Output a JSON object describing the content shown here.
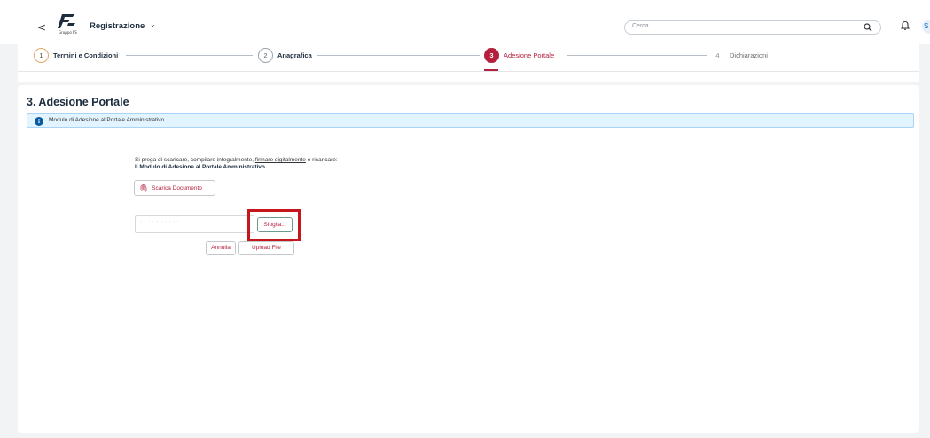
{
  "shell": {
    "back_glyph": "<",
    "logo_caption": "Gruppo FS",
    "app_title": "Registrazione",
    "app_menu_glyph": "⌄",
    "search_placeholder": "Cerca",
    "avatar_initial": "S"
  },
  "wizard": {
    "steps": [
      {
        "number": "1",
        "label": "Termini e Condizioni",
        "state": "done"
      },
      {
        "number": "2",
        "label": "Anagrafica",
        "state": "done"
      },
      {
        "number": "3",
        "label": "Adesione Portale",
        "state": "active"
      },
      {
        "number": "4",
        "label": "Dichiarazioni",
        "state": "inactive"
      }
    ]
  },
  "section": {
    "title": "3. Adesione Portale",
    "info_text": "Modulo di Adesione al Portale Amministrativo",
    "instruction_prefix": "Si prega di scaricare, compilare integralmente, ",
    "instruction_link": "firmare digitalmente",
    "instruction_suffix": " e ricaricare:",
    "instruction_bold": "Il Modulo di Adesione al Portale Amministrativo",
    "download_label": "Scarica Documento",
    "file_placeholder": "· · · · · · · · · ·",
    "browse_label": "Sfoglia...",
    "cancel_label": "Annulla",
    "upload_label": "Upload File"
  },
  "colors": {
    "accent": "#b4203e",
    "info_bg": "#e1f4ff",
    "highlight": "#c4161c"
  }
}
